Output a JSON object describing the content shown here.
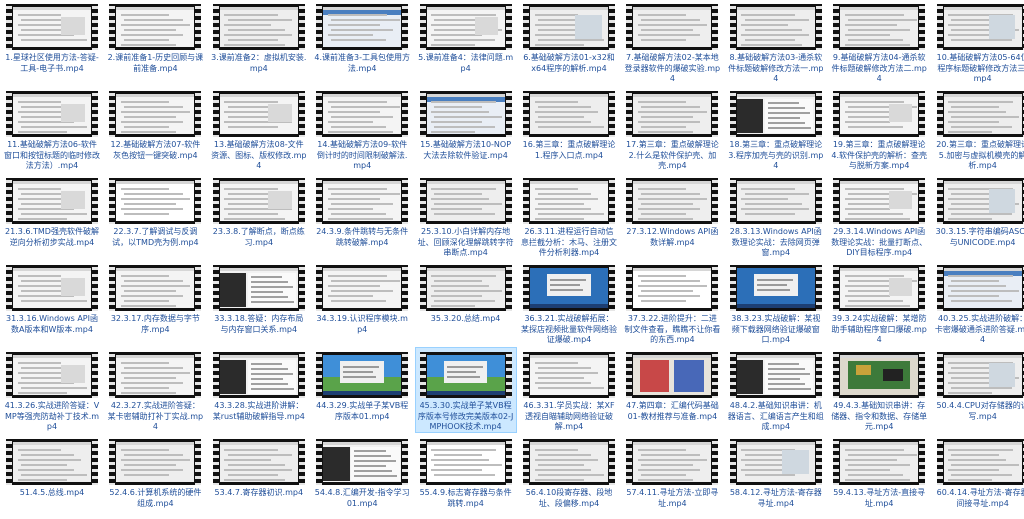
{
  "view": {
    "mode": "large-icons",
    "selected_index": 44
  },
  "files": [
    {
      "name": "1.星球社区使用方法-答疑-工具-电子书.mp4",
      "thumb": "doc"
    },
    {
      "name": "2.课前准备1-历史回顾与课前准备.mp4",
      "thumb": "doc"
    },
    {
      "name": "3.课前准备2：虚拟机安装.mp4",
      "thumb": "light"
    },
    {
      "name": "4.课前准备3-工具包使用方法.mp4",
      "thumb": "blue"
    },
    {
      "name": "5.课前准备4：法律问题.mp4",
      "thumb": "doc"
    },
    {
      "name": "6.基础破解方法01-x32和x64程序的解析.mp4",
      "thumb": "light"
    },
    {
      "name": "7.基础破解方法02-某本地登录器软件的爆破实验.mp4",
      "thumb": "light"
    },
    {
      "name": "8.基础破解方法03-通杀软件标题破解修改方法一.mp4",
      "thumb": "light"
    },
    {
      "name": "9.基础破解方法04-通杀软件标题破解修改方法二.mp4",
      "thumb": "light"
    },
    {
      "name": "10.基础破解方法05-64位程序标题破解修改方法三.mp4",
      "thumb": "light"
    },
    {
      "name": "11.基础破解方法06-软件窗口和按钮标题的临时修改法方法）.mp4",
      "thumb": "doc"
    },
    {
      "name": "12.基础破解方法07-软件灰色按钮一键突破.mp4",
      "thumb": "doc"
    },
    {
      "name": "13.基础破解方法08-文件资源、图标、版权修改.mp4",
      "thumb": "doc"
    },
    {
      "name": "14.基础破解方法09-软件倒计时的时间限制破解法.mp4",
      "thumb": "doc"
    },
    {
      "name": "15.基础破解方法10-NOP大法去除软件验证.mp4",
      "thumb": "blue"
    },
    {
      "name": "16.第三章：重点破解理论1.程序入口点.mp4",
      "thumb": "light"
    },
    {
      "name": "17.第三章：重点破解理论2.什么是软件保护壳、加壳.mp4",
      "thumb": "light"
    },
    {
      "name": "18.第三章：重点破解理论3.程序加壳与壳的识别.mp4",
      "thumb": "code"
    },
    {
      "name": "19.第三章：重点破解理论4.软件保护壳的解析：查壳与脱新方案.mp4",
      "thumb": "doc"
    },
    {
      "name": "20.第三章：重点破解理论5.加密与虚拟机模壳的解析.mp4",
      "thumb": "light"
    },
    {
      "name": "21.3.6.TMD强壳软件破解逆向分析初步实战.mp4",
      "thumb": "doc"
    },
    {
      "name": "22.3.7.了解调试与反调试，以TMD壳为例.mp4",
      "thumb": "white"
    },
    {
      "name": "23.3.8.了解断点，断点练习.mp4",
      "thumb": "doc"
    },
    {
      "name": "24.3.9.条件跳转与无条件跳转破解.mp4",
      "thumb": "doc"
    },
    {
      "name": "25.3.10.小白详解内存地址、回顾深化理解跳转字符串断点.mp4",
      "thumb": "light"
    },
    {
      "name": "26.3.11.进程运行自动信息拦截分析：木马、注册文件分析利器.mp4",
      "thumb": "doc"
    },
    {
      "name": "27.3.12.Windows API函数详解.mp4",
      "thumb": "light"
    },
    {
      "name": "28.3.13.Windows API函数理论实战：去除网页弹窗.mp4",
      "thumb": "light"
    },
    {
      "name": "29.3.14.Windows API函数理论实战：批量打断点、DIY目标程序.mp4",
      "thumb": "doc"
    },
    {
      "name": "30.3.15.字符串编码ASCII与UNICODE.mp4",
      "thumb": "light"
    },
    {
      "name": "31.3.16.Windows API函数A版本和W版本.mp4",
      "thumb": "doc"
    },
    {
      "name": "32.3.17.内存数据与字节序.mp4",
      "thumb": "doc"
    },
    {
      "name": "33.3.18.答疑：内存布局与内存窗口关系.mp4",
      "thumb": "code"
    },
    {
      "name": "34.3.19.认识程序模块.mp4",
      "thumb": "doc"
    },
    {
      "name": "35.3.20.总结.mp4",
      "thumb": "light"
    },
    {
      "name": "36.3.21.实战破解拓展：某探店视频批量软件网络验证爆破.mp4",
      "thumb": "desktop"
    },
    {
      "name": "37.3.22.进阶提升：二进制文件查看，瞧瞧不让你看的东西.mp4",
      "thumb": "white"
    },
    {
      "name": "38.3.23.实战破解：某视频下载器网络验证爆破窗口.mp4",
      "thumb": "desktop"
    },
    {
      "name": "39.3.24实战破解：某增防助手辅助程序窗口爆破.mp4",
      "thumb": "doc"
    },
    {
      "name": "40.3.25.实战进阶破解：卡密爆破通杀进阶答疑.mp4",
      "thumb": "blue"
    },
    {
      "name": "41.3.26.实战进阶答疑：VMP等强壳防劫补丁技术.mp4",
      "thumb": "doc"
    },
    {
      "name": "42.3.27.实战进阶答疑：某卡密辅助打补丁实战.mp4",
      "thumb": "doc"
    },
    {
      "name": "43.3.28.实战进阶讲解：某rust辅助破解指导.mp4",
      "thumb": "code"
    },
    {
      "name": "44.3.29.实战单子某VB程序版本01.mp4",
      "thumb": "xp"
    },
    {
      "name": "45.3.30.实战单子某VB程序版本号修改完美版本02-JMPHOOK技术.mp4",
      "thumb": "xp"
    },
    {
      "name": "46.3.31.学员实战：某XF透视自瞄辅助网络验证破解.mp4",
      "thumb": "doc"
    },
    {
      "name": "47.第四章：汇编代码基础01-教材推荐与准备.mp4",
      "thumb": "book"
    },
    {
      "name": "48.4.2.基础知识串讲：机器语言、汇编语言产生和组成.mp4",
      "thumb": "code"
    },
    {
      "name": "49.4.3.基础知识串讲：存储器、指令和数据、存储单元.mp4",
      "thumb": "board"
    },
    {
      "name": "50.4.4.CPU对存储器的读写.mp4",
      "thumb": "light"
    },
    {
      "name": "51.4.5.总线.mp4",
      "thumb": "light"
    },
    {
      "name": "52.4.6.计算机系统的硬件组成.mp4",
      "thumb": "light"
    },
    {
      "name": "53.4.7.寄存器初识.mp4",
      "thumb": "light"
    },
    {
      "name": "54.4.8.汇编开发-指令学习01.mp4",
      "thumb": "code"
    },
    {
      "name": "55.4.9.标志寄存器与条件跳转.mp4",
      "thumb": "white"
    },
    {
      "name": "56.4.10段寄存器、段地址、段偏移.mp4",
      "thumb": "light"
    },
    {
      "name": "57.4.11.寻址方法-立即寻址.mp4",
      "thumb": "light"
    },
    {
      "name": "58.4.12.寻址方法-寄存器寻址.mp4",
      "thumb": "light"
    },
    {
      "name": "59.4.13.寻址方法-直接寻址.mp4",
      "thumb": "light"
    },
    {
      "name": "60.4.14.寻址方法-寄存器间接寻址.mp4",
      "thumb": "light"
    }
  ]
}
